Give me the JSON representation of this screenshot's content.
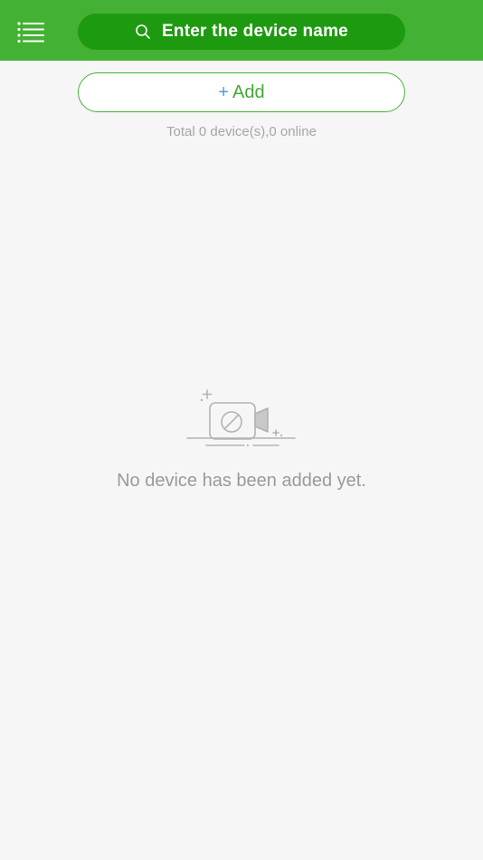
{
  "header": {
    "menu_icon": "hamburger-menu-icon",
    "search": {
      "icon": "search-icon",
      "placeholder": "Enter the device name"
    }
  },
  "add_button": {
    "plus": "+",
    "label": "Add"
  },
  "summary": {
    "text": "Total 0 device(s),0 online"
  },
  "empty_state": {
    "icon": "camera-disabled-icon",
    "message": "No device has been added yet."
  },
  "colors": {
    "header_bg": "#43b133",
    "search_bg": "#1e9a10",
    "accent_green": "#43b133",
    "plus_blue": "#4aa1e0",
    "background": "#f6f6f6",
    "muted_text": "#a6a6a6"
  }
}
